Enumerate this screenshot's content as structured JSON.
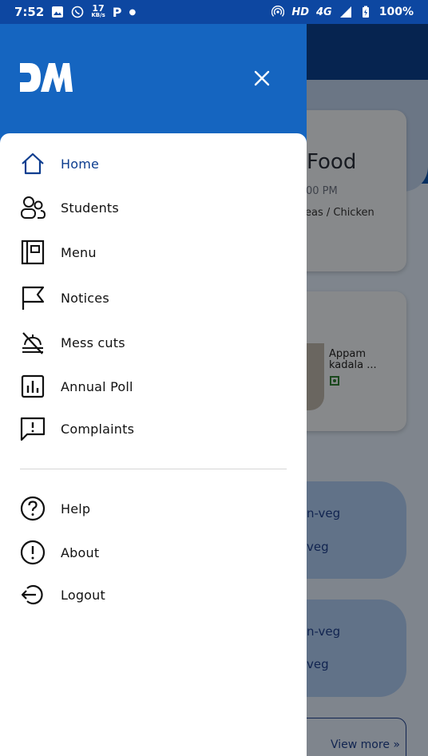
{
  "status_bar": {
    "time": "7:52",
    "speed_value": "17",
    "speed_unit": "KB/s",
    "p_label": "P",
    "network": "HD",
    "network_type": "4G",
    "battery": "100%"
  },
  "background": {
    "card1": {
      "title": "Food",
      "time": "00 PM",
      "items": "eas / Chicken"
    },
    "card2": {
      "dish": "Appam kadala ..."
    },
    "pill1": {
      "line1": "n-veg",
      "line2": "veg"
    },
    "pill2": {
      "line1": "n-veg",
      "line2": "veg"
    },
    "view_more": "View more »"
  },
  "drawer": {
    "logo_text": "DM",
    "menu": [
      {
        "label": "Home",
        "icon": "home-icon"
      },
      {
        "label": "Students",
        "icon": "people-icon"
      },
      {
        "label": "Menu",
        "icon": "menu-book-icon"
      },
      {
        "label": "Notices",
        "icon": "flag-icon"
      },
      {
        "label": "Mess cuts",
        "icon": "no-meals-icon"
      },
      {
        "label": "Annual Poll",
        "icon": "poll-icon"
      },
      {
        "label": "Complaints",
        "icon": "feedback-icon"
      }
    ],
    "secondary": [
      {
        "label": "Help",
        "icon": "help-icon"
      },
      {
        "label": "About",
        "icon": "info-icon"
      },
      {
        "label": "Logout",
        "icon": "logout-icon"
      }
    ]
  },
  "colors": {
    "status_bar": "#0d47a1",
    "drawer_header": "#1565c0",
    "active_item": "#0d3d8f"
  }
}
